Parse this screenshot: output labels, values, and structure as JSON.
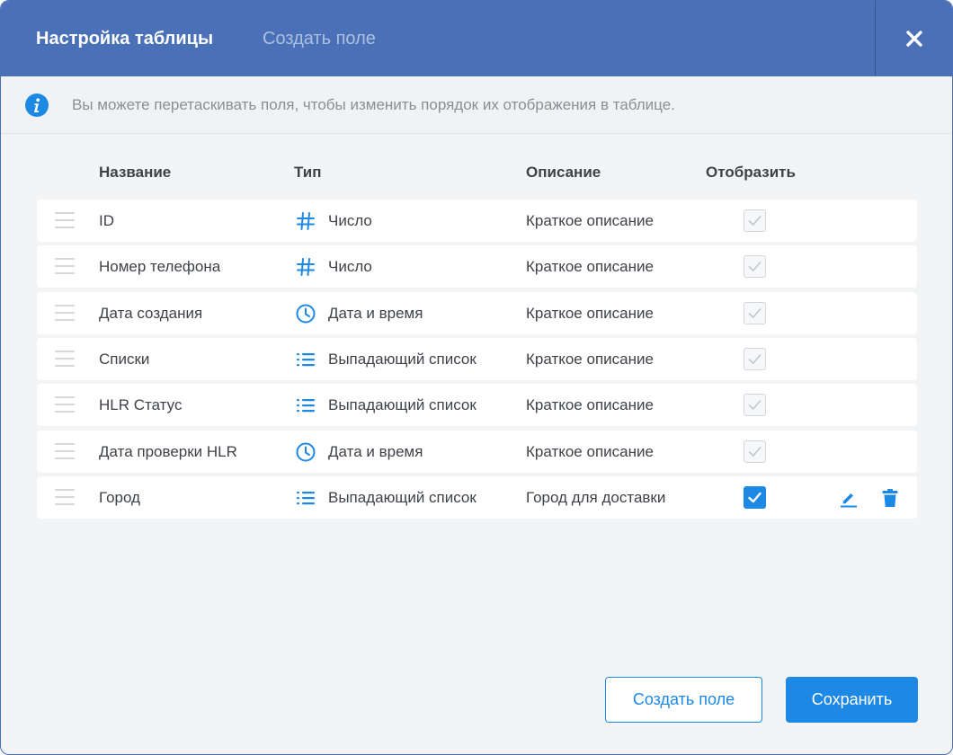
{
  "header": {
    "tab_settings": "Настройка таблицы",
    "tab_create": "Создать поле",
    "close_icon": "close-icon",
    "background": "#4a70b8"
  },
  "info": {
    "text": "Вы можете перетаскивать поля, чтобы изменить порядок их отображения в таблице.",
    "icon": "info-icon",
    "color": "#1e88e5"
  },
  "columns": {
    "name": "Название",
    "type": "Тип",
    "description": "Описание",
    "display": "Отобразить"
  },
  "rows": [
    {
      "name": "ID",
      "type": "Число",
      "type_icon": "hash-icon",
      "description": "Краткое описание",
      "display": true,
      "editable": false
    },
    {
      "name": "Номер телефона",
      "type": "Число",
      "type_icon": "hash-icon",
      "description": "Краткое описание",
      "display": true,
      "editable": false
    },
    {
      "name": "Дата создания",
      "type": "Дата и время",
      "type_icon": "clock-icon",
      "description": "Краткое описание",
      "display": true,
      "editable": false
    },
    {
      "name": "Списки",
      "type": "Выпадающий список",
      "type_icon": "list-icon",
      "description": "Краткое описание",
      "display": true,
      "editable": false
    },
    {
      "name": "HLR Статус",
      "type": "Выпадающий список",
      "type_icon": "list-icon",
      "description": "Краткое описание",
      "display": true,
      "editable": false
    },
    {
      "name": "Дата проверки HLR",
      "type": "Дата и время",
      "type_icon": "clock-icon",
      "description": "Краткое описание",
      "display": true,
      "editable": false
    },
    {
      "name": "Город",
      "type": "Выпадающий список",
      "type_icon": "list-icon",
      "description": "Город для доставки",
      "display": true,
      "editable": true
    }
  ],
  "footer": {
    "create_label": "Создать поле",
    "save_label": "Сохранить"
  },
  "colors": {
    "accent": "#1e88e5",
    "header": "#4a70b8"
  }
}
